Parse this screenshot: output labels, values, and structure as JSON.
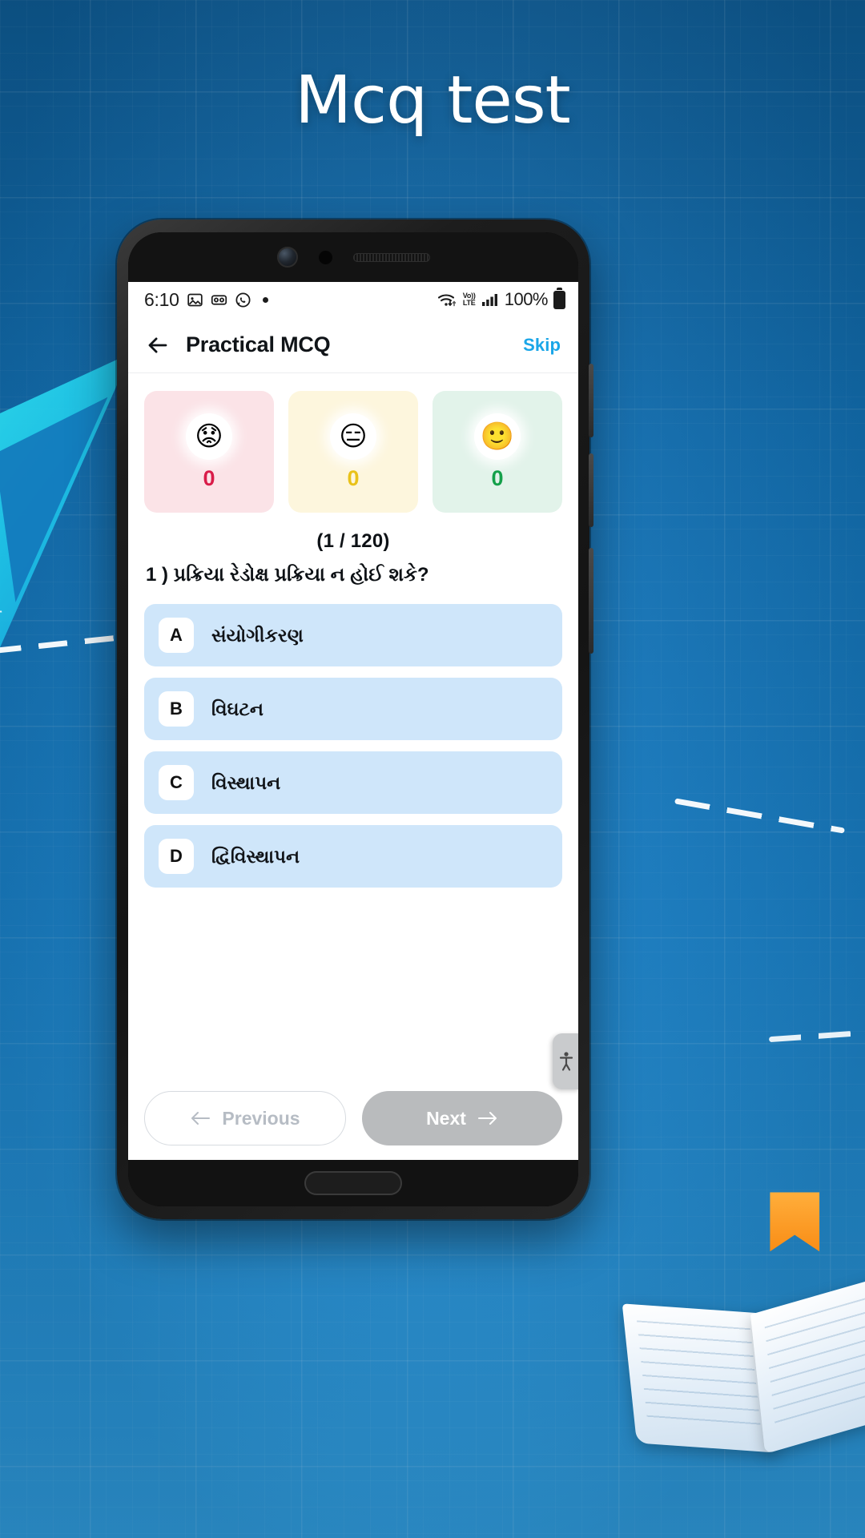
{
  "page": {
    "title": "Mcq test",
    "background_color": "#1273b8"
  },
  "phone": {
    "status_bar": {
      "time": "6:10",
      "left_icons": [
        "image-icon",
        "voicemail-icon",
        "whatsapp-icon",
        "dot-indicator"
      ],
      "wifi_icon": "wifi-icon",
      "volte_line1": "Vo))",
      "volte_line2": "LTE",
      "signal_icon": "signal-bars-icon",
      "battery_percent": "100%",
      "battery_icon": "battery-full-icon"
    },
    "app_bar": {
      "back_icon": "arrow-left-icon",
      "title": "Practical MCQ",
      "skip_label": "Skip",
      "skip_color": "#1aa6e8"
    },
    "scores": [
      {
        "name": "wrong",
        "emoji": "😟",
        "emoji_name": "worried-face-emoji",
        "count": "0",
        "bg": "#fbe3e7",
        "color": "#d91c49"
      },
      {
        "name": "skipped",
        "emoji": "😑",
        "emoji_name": "unamused-face-emoji",
        "count": "0",
        "bg": "#fdf6dd",
        "color": "#e9c21a"
      },
      {
        "name": "correct",
        "emoji": "🙂",
        "emoji_name": "slightly-smiling-face-emoji",
        "count": "0",
        "bg": "#e2f3ea",
        "color": "#14a04a"
      }
    ],
    "question": {
      "counter": "(1 / 120)",
      "text": "1 ) પ્રક્રિયા રેડોક્ષ પ્રક્રિયા ન હોઈ શકે?",
      "options": [
        {
          "key": "A",
          "label": "સંયોગીકરણ"
        },
        {
          "key": "B",
          "label": "વિઘટન"
        },
        {
          "key": "C",
          "label": "વિસ્થાપન"
        },
        {
          "key": "D",
          "label": "દ્વિવિસ્થાપન"
        }
      ]
    },
    "nav": {
      "previous_label": "Previous",
      "previous_icon": "arrow-left-icon",
      "next_label": "Next",
      "next_icon": "arrow-right-icon"
    },
    "accessibility_fab_icon": "accessibility-icon"
  }
}
